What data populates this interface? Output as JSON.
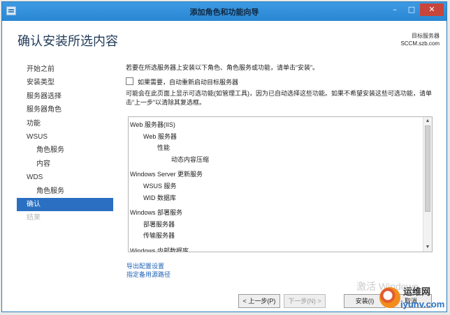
{
  "window": {
    "title": "添加角色和功能向导",
    "controls": [
      "minimize-icon",
      "maximize-icon",
      "close-icon"
    ]
  },
  "header": {
    "page_title": "确认安装所选内容",
    "target_label": "目标服务器",
    "target_value": "SCCM.szb.com"
  },
  "sidebar": {
    "items": [
      {
        "label": "开始之前"
      },
      {
        "label": "安装类型"
      },
      {
        "label": "服务器选择"
      },
      {
        "label": "服务器角色"
      },
      {
        "label": "功能"
      },
      {
        "label": "WSUS"
      },
      {
        "label": "角色服务"
      },
      {
        "label": "内容"
      },
      {
        "label": "WDS"
      },
      {
        "label": "角色服务"
      },
      {
        "label": "确认"
      },
      {
        "label": "结果"
      }
    ]
  },
  "content": {
    "instruction": "若要在所选服务器上安装以下角色、角色服务或功能，请单击“安装”。",
    "restart_checkbox_label": "如果需要，自动重新启动目标服务器",
    "restart_checked": false,
    "note": "可能会在此页面上显示可选功能(如管理工具)，因为已自动选择这些功能。如果不希望安装这些可选功能，请单击“上一步”以清除其复选框。",
    "tree": [
      {
        "text": "Web 服务器(IIS)"
      },
      {
        "text": "Web 服务器"
      },
      {
        "text": "性能"
      },
      {
        "text": "动态内容压缩"
      },
      {
        "text": "Windows Server 更新服务"
      },
      {
        "text": "WSUS 服务"
      },
      {
        "text": "WID 数据库"
      },
      {
        "text": "Windows 部署服务"
      },
      {
        "text": "部署服务器"
      },
      {
        "text": "传输服务器"
      },
      {
        "text": "Windows 内部数据库"
      }
    ],
    "export_link": "导出配置设置",
    "alt_source_link": "指定备用源路径"
  },
  "footer": {
    "prev_label": "< 上一步(P)",
    "next_label": "下一步(N) >",
    "install_label": "安装(I)",
    "cancel_label": "取消"
  },
  "watermark": {
    "activate_text": "激活 Windows",
    "site_name": "运维网",
    "site_url": "iyunv.com"
  }
}
